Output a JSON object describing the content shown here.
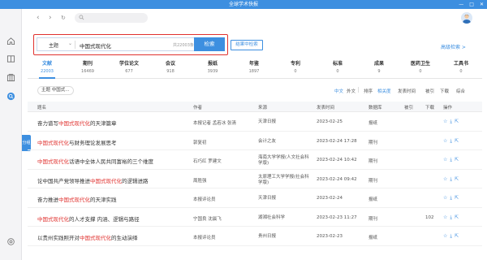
{
  "window": {
    "title": "全球学术快报",
    "controls": [
      "—",
      "□",
      "✕"
    ]
  },
  "toolbar": {
    "back_arrow": "‹",
    "forward_arrow": "›",
    "refresh": "↻"
  },
  "search": {
    "field": "主题",
    "query": "中国式现代化",
    "count": "共22003条",
    "button": "检索",
    "within": "结果中检索",
    "advanced": "高级检索 >"
  },
  "categories": [
    {
      "label": "文献",
      "count": "22003",
      "active": true
    },
    {
      "label": "期刊",
      "count": "16469"
    },
    {
      "label": "学位论文",
      "count": "677"
    },
    {
      "label": "会议",
      "count": "918"
    },
    {
      "label": "报纸",
      "count": "3939"
    },
    {
      "label": "年鉴",
      "count": "1897"
    },
    {
      "label": "专利",
      "count": "0"
    },
    {
      "label": "标准",
      "count": "0"
    },
    {
      "label": "成果",
      "count": "9"
    },
    {
      "label": "医药卫生",
      "count": "0"
    },
    {
      "label": "工具书",
      "count": "0"
    }
  ],
  "filters": {
    "topic_label": "主题",
    "topic_value": "中国式...",
    "lang_zh": "中文",
    "lang_foreign": "外文",
    "sort_label": "排序",
    "sort_relevance": "相关度",
    "sort_date": "发表时间",
    "sort_cited": "被引",
    "sort_download": "下载",
    "sort_overall": "综合"
  },
  "float_tab": "分组",
  "table": {
    "headers": {
      "title": "题名",
      "author": "作者",
      "source": "来源",
      "date": "发表时间",
      "db": "数据库",
      "cited": "被引",
      "downloads": "下载",
      "ops": "操作"
    },
    "rows": [
      {
        "pre": "奋力谱写",
        "hl": "中国式现代化",
        "post": "的天津篇章",
        "author": "本报记者 孟若冰 张清",
        "source": "天津日报",
        "date": "2023-02-25",
        "db": "报纸",
        "cited": "",
        "downloads": ""
      },
      {
        "pre": "",
        "hl": "中国式现代化",
        "post": "与财务理论发展思考",
        "author": "郭复初",
        "source": "会计之友",
        "date": "2023-02-24 17:28",
        "db": "期刊",
        "cited": "",
        "downloads": ""
      },
      {
        "pre": "",
        "hl": "中国式现代化",
        "post": "话语中全体人民共同富裕的三个维度",
        "author": "石巧红 罗建文",
        "source": "海南大学学报(人文社会科学版)",
        "date": "2023-02-24 10:42",
        "db": "期刊",
        "cited": "",
        "downloads": ""
      },
      {
        "pre": "论中国共产党领导推进",
        "hl": "中国式现代化",
        "post": "的逻辑进路",
        "author": "周胜强",
        "source": "太原理工大学学报(社会科学版)",
        "date": "2023-02-24 09:42",
        "db": "期刊",
        "cited": "",
        "downloads": ""
      },
      {
        "pre": "奋力推进",
        "hl": "中国式现代化",
        "post": "的天津实践",
        "author": "本报评论员",
        "source": "天津日报",
        "date": "2023-02-24",
        "db": "报纸",
        "cited": "",
        "downloads": ""
      },
      {
        "pre": "",
        "hl": "中国式现代化",
        "post": "的人才支撑 内涵、逻辑与路径",
        "author": "宁国良 沈晨飞",
        "source": "湖湘社会科学",
        "date": "2023-02-23 11:27",
        "db": "期刊",
        "cited": "",
        "downloads": "102"
      },
      {
        "pre": "以贵州实践照开对",
        "hl": "中国式现代化",
        "post": "的生动演绎",
        "author": "本报评论员",
        "source": "贵州日报",
        "date": "2023-02-23",
        "db": "报纸",
        "cited": "",
        "downloads": ""
      }
    ]
  }
}
